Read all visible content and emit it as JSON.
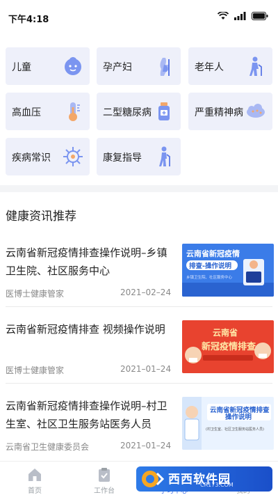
{
  "status_bar": {
    "time": "下午4:18"
  },
  "categories": [
    {
      "label": "儿童",
      "icon": "baby-face-icon"
    },
    {
      "label": "孕产妇",
      "icon": "pregnant-icon"
    },
    {
      "label": "老年人",
      "icon": "elderly-icon"
    },
    {
      "label": "高血压",
      "icon": "thermometer-icon"
    },
    {
      "label": "二型糖尿病",
      "icon": "medicine-bottle-icon"
    },
    {
      "label": "严重精神病",
      "icon": "brain-cloud-icon"
    },
    {
      "label": "疾病常识",
      "icon": "virus-icon"
    },
    {
      "label": "康复指导",
      "icon": "walking-cane-icon"
    }
  ],
  "section": {
    "title": "健康资讯推荐"
  },
  "news": [
    {
      "title": "云南省新冠疫情排查操作说明–乡镇卫生院、社区服务中心",
      "source": "医博士健康管家",
      "date": "2021–02–24",
      "thumb_title": "云南省新冠疫情排查-操作说明",
      "thumb_caption": "乡镇卫生院、社区服务中心"
    },
    {
      "title": "云南省新冠疫情排查 视频操作说明",
      "source": "医博士健康管家",
      "date": "2021–01–24",
      "thumb_title_1": "云南省",
      "thumb_title_2": "新冠疫情排查"
    },
    {
      "title": "云南省新冠疫情排查操作说明–村卫生室、社区卫生服务站医务人员",
      "source": "云南省卫生健康委员会",
      "date": "2021–01–24",
      "thumb_title_1": "云南省新冠疫情排查",
      "thumb_title_2": "操作说明",
      "thumb_caption": "(村卫生室、社区卫生服务站医务人员)"
    }
  ],
  "tabs": [
    {
      "label": "首页",
      "icon": "home-icon",
      "active": false
    },
    {
      "label": "工作台",
      "icon": "clipboard-check-icon",
      "active": false
    },
    {
      "label": "学习中心",
      "icon": "book-icon",
      "active": true
    },
    {
      "label": "我的",
      "icon": "person-icon",
      "active": false
    }
  ],
  "watermark": {
    "text": "西西软件园",
    "sub": "CR173.COM"
  },
  "colors": {
    "accent": "#3d6ce6",
    "tile_bg": "#eef0fa",
    "icon_blue": "#7b95f0"
  }
}
